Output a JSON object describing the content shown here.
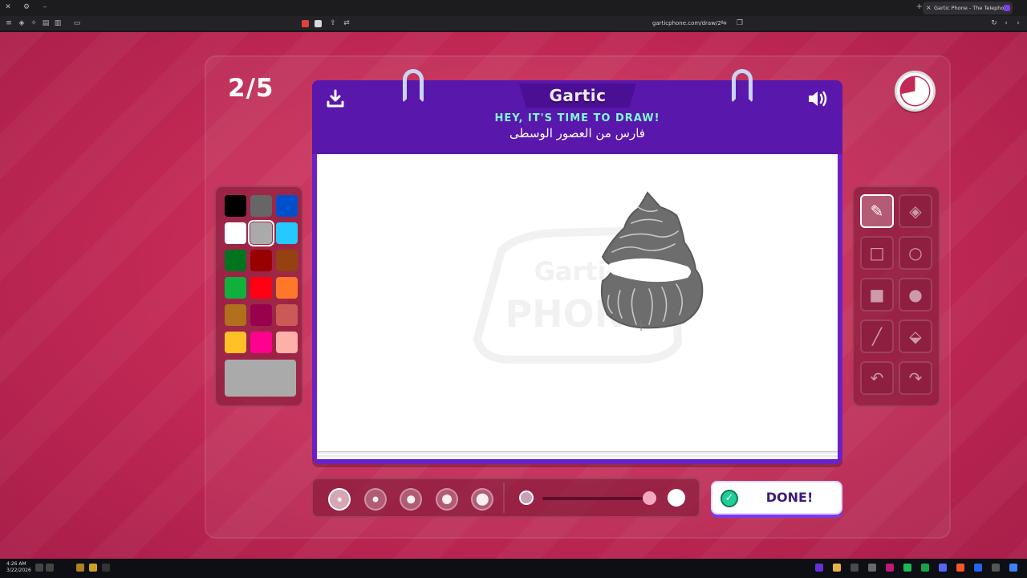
{
  "browser": {
    "tab_title": "Gartic Phone - The Telephone G",
    "url": "garticphone.com/draw/2",
    "new_tab_glyph": "+",
    "tab_close_glyph": "×"
  },
  "game": {
    "round": "2/5",
    "logo": "Gartic",
    "headline": "HEY, IT'S TIME TO DRAW!",
    "prompt": "فارس من العصور الوسطى",
    "done_label": "DONE!",
    "watermark_top": "Gartic",
    "watermark_bottom": "PHONE"
  },
  "palette": {
    "colors": [
      "#000000",
      "#666666",
      "#0050cd",
      "#ffffff",
      "#aaaaaa",
      "#26c9ff",
      "#017420",
      "#990000",
      "#964112",
      "#11b03c",
      "#ff0013",
      "#ff7829",
      "#b0701c",
      "#99004e",
      "#cb5a57",
      "#ffc126",
      "#ff008f",
      "#feafa8"
    ],
    "selected_index": 4,
    "current": "#aaaaaa"
  },
  "tools": [
    {
      "name": "pen",
      "icon": "pencil-icon",
      "active": true
    },
    {
      "name": "eraser",
      "icon": "eraser-icon",
      "active": false
    },
    {
      "name": "rectangle",
      "icon": "rectangle-outline-icon",
      "active": false
    },
    {
      "name": "ellipse",
      "icon": "circle-outline-icon",
      "active": false
    },
    {
      "name": "filled-rectangle",
      "icon": "rectangle-filled-icon",
      "active": false
    },
    {
      "name": "filled-ellipse",
      "icon": "circle-filled-icon",
      "active": false
    },
    {
      "name": "line",
      "icon": "line-icon",
      "active": false
    },
    {
      "name": "fill",
      "icon": "paint-bucket-icon",
      "active": false
    },
    {
      "name": "undo",
      "icon": "undo-icon",
      "active": false
    },
    {
      "name": "redo",
      "icon": "redo-icon",
      "active": false
    }
  ],
  "brush": {
    "sizes": [
      1,
      2,
      3,
      4,
      5
    ],
    "selected_size": 1,
    "opacity": 0.95
  },
  "taskbar": {
    "time": "4:26 AM",
    "date": "3/22/2026"
  },
  "colors": {
    "background": "#c42a55",
    "board": "#6b21c8",
    "headline": "#7dffd9",
    "done_check": "#1ecf9a"
  }
}
